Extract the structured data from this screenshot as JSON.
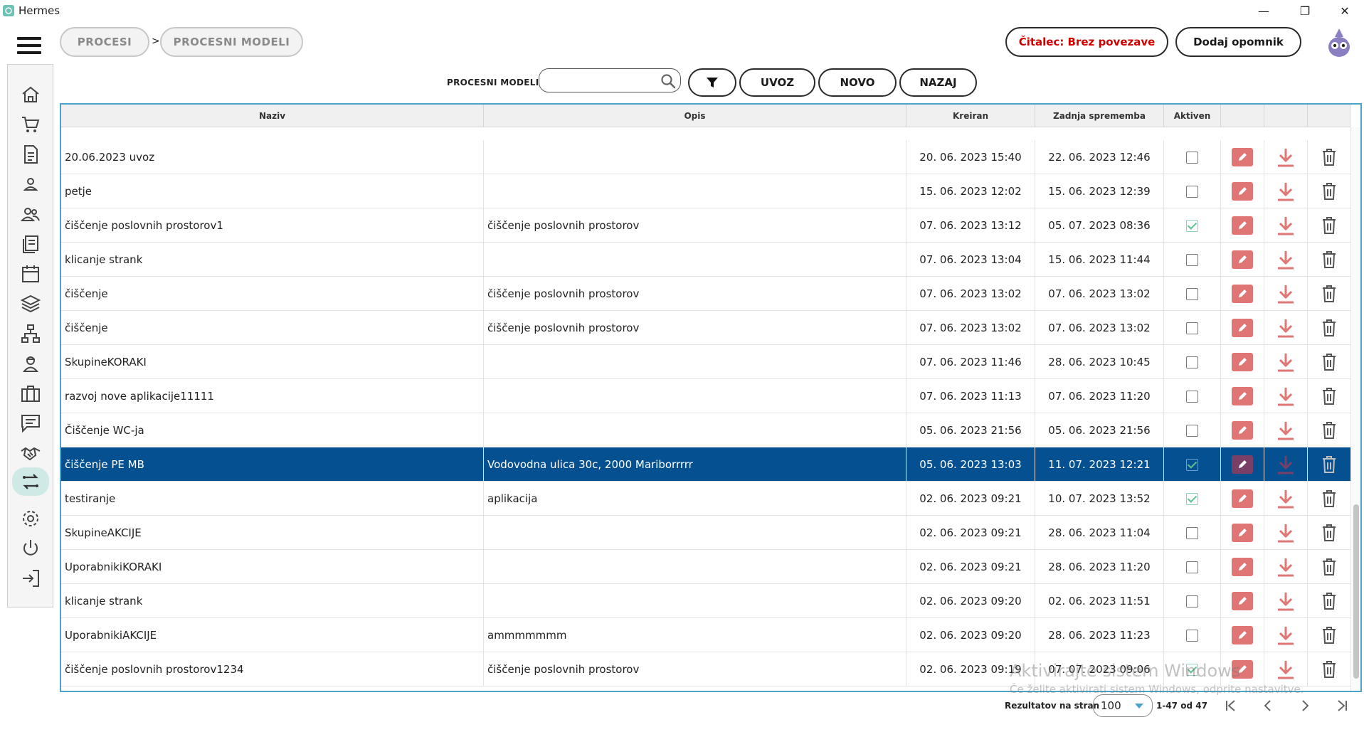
{
  "window": {
    "title": "Hermes"
  },
  "breadcrumb": {
    "items": [
      "PROCESI",
      "PROCESNI MODELI"
    ],
    "separator": ">"
  },
  "header": {
    "reader_status": "Čitalec: Brez povezave",
    "add_reminder": "Dodaj opomnik"
  },
  "toolbar": {
    "label": "PROCESNI MODELI",
    "search_value": "",
    "search_placeholder": "",
    "import": "UVOZ",
    "new": "NOVO",
    "back": "NAZAJ"
  },
  "colors": {
    "accent": "#4aa3c9",
    "selected_row": "#045091",
    "edit": "#e07575",
    "download": "#e07575",
    "active_nav": "#cfe9e6"
  },
  "sidebar": {
    "items": [
      "home-icon",
      "cart-icon",
      "document-icon",
      "user-icon",
      "users-icon",
      "list-icon",
      "calendar-icon",
      "layers-icon",
      "network-icon",
      "worker-icon",
      "briefcase-icon",
      "chat-icon",
      "handshake-icon",
      "process-icon",
      "settings-icon",
      "power-icon",
      "logout-icon"
    ],
    "active": "process-icon"
  },
  "table": {
    "columns": [
      "Naziv",
      "Opis",
      "Kreiran",
      "Zadnja sprememba",
      "Aktiven"
    ],
    "rows": [
      {
        "name": "20.06.2023 uvoz",
        "desc": "",
        "created": "20. 06. 2023 15:40",
        "modified": "22. 06. 2023 12:46",
        "active": false
      },
      {
        "name": "petje",
        "desc": "",
        "created": "15. 06. 2023 12:02",
        "modified": "15. 06. 2023 12:39",
        "active": false
      },
      {
        "name": "čiščenje poslovnih prostorov1",
        "desc": "čiščenje poslovnih prostorov",
        "created": "07. 06. 2023 13:12",
        "modified": "05. 07. 2023 08:36",
        "active": true
      },
      {
        "name": "klicanje strank",
        "desc": "",
        "created": "07. 06. 2023 13:04",
        "modified": "15. 06. 2023 11:44",
        "active": false
      },
      {
        "name": "čiščenje",
        "desc": "čiščenje poslovnih prostorov",
        "created": "07. 06. 2023 13:02",
        "modified": "07. 06. 2023 13:02",
        "active": false
      },
      {
        "name": "čiščenje",
        "desc": "čiščenje poslovnih prostorov",
        "created": "07. 06. 2023 13:02",
        "modified": "07. 06. 2023 13:02",
        "active": false
      },
      {
        "name": "SkupineKORAKI",
        "desc": "",
        "created": "07. 06. 2023 11:46",
        "modified": "28. 06. 2023 10:45",
        "active": false
      },
      {
        "name": "razvoj nove aplikacije11111",
        "desc": "",
        "created": "07. 06. 2023 11:13",
        "modified": "07. 06. 2023 11:20",
        "active": false
      },
      {
        "name": "Čiščenje WC-ja",
        "desc": "",
        "created": "05. 06. 2023 21:56",
        "modified": "05. 06. 2023 21:56",
        "active": false
      },
      {
        "name": "čiščenje PE MB",
        "desc": "Vodovodna ulica 30c, 2000 Mariborrrrr",
        "created": "05. 06. 2023 13:03",
        "modified": "11. 07. 2023 12:21",
        "active": true,
        "selected": true
      },
      {
        "name": "testiranje",
        "desc": "aplikacija",
        "created": "02. 06. 2023 09:21",
        "modified": "10. 07. 2023 13:52",
        "active": true
      },
      {
        "name": "SkupineAKCIJE",
        "desc": "",
        "created": "02. 06. 2023 09:21",
        "modified": "28. 06. 2023 11:04",
        "active": false
      },
      {
        "name": "UporabnikiKORAKI",
        "desc": "",
        "created": "02. 06. 2023 09:21",
        "modified": "28. 06. 2023 11:20",
        "active": false
      },
      {
        "name": "klicanje strank",
        "desc": "",
        "created": "02. 06. 2023 09:20",
        "modified": "02. 06. 2023 11:51",
        "active": false
      },
      {
        "name": "UporabnikiAKCIJE",
        "desc": "ammmmmmm",
        "created": "02. 06. 2023 09:20",
        "modified": "28. 06. 2023 11:23",
        "active": false
      },
      {
        "name": "čiščenje poslovnih prostorov1234",
        "desc": "čiščenje poslovnih prostorov",
        "created": "02. 06. 2023 09:19",
        "modified": "07. 07. 2023 09:06",
        "active": true
      }
    ]
  },
  "pagination": {
    "label": "Rezultatov na stran",
    "page_size": "100",
    "range": "1-47 od 47"
  },
  "watermark": {
    "line1": "Aktivirajte sistem Windows",
    "line2": "Če želite aktivirati sistem Windows, odprite nastavitve."
  }
}
